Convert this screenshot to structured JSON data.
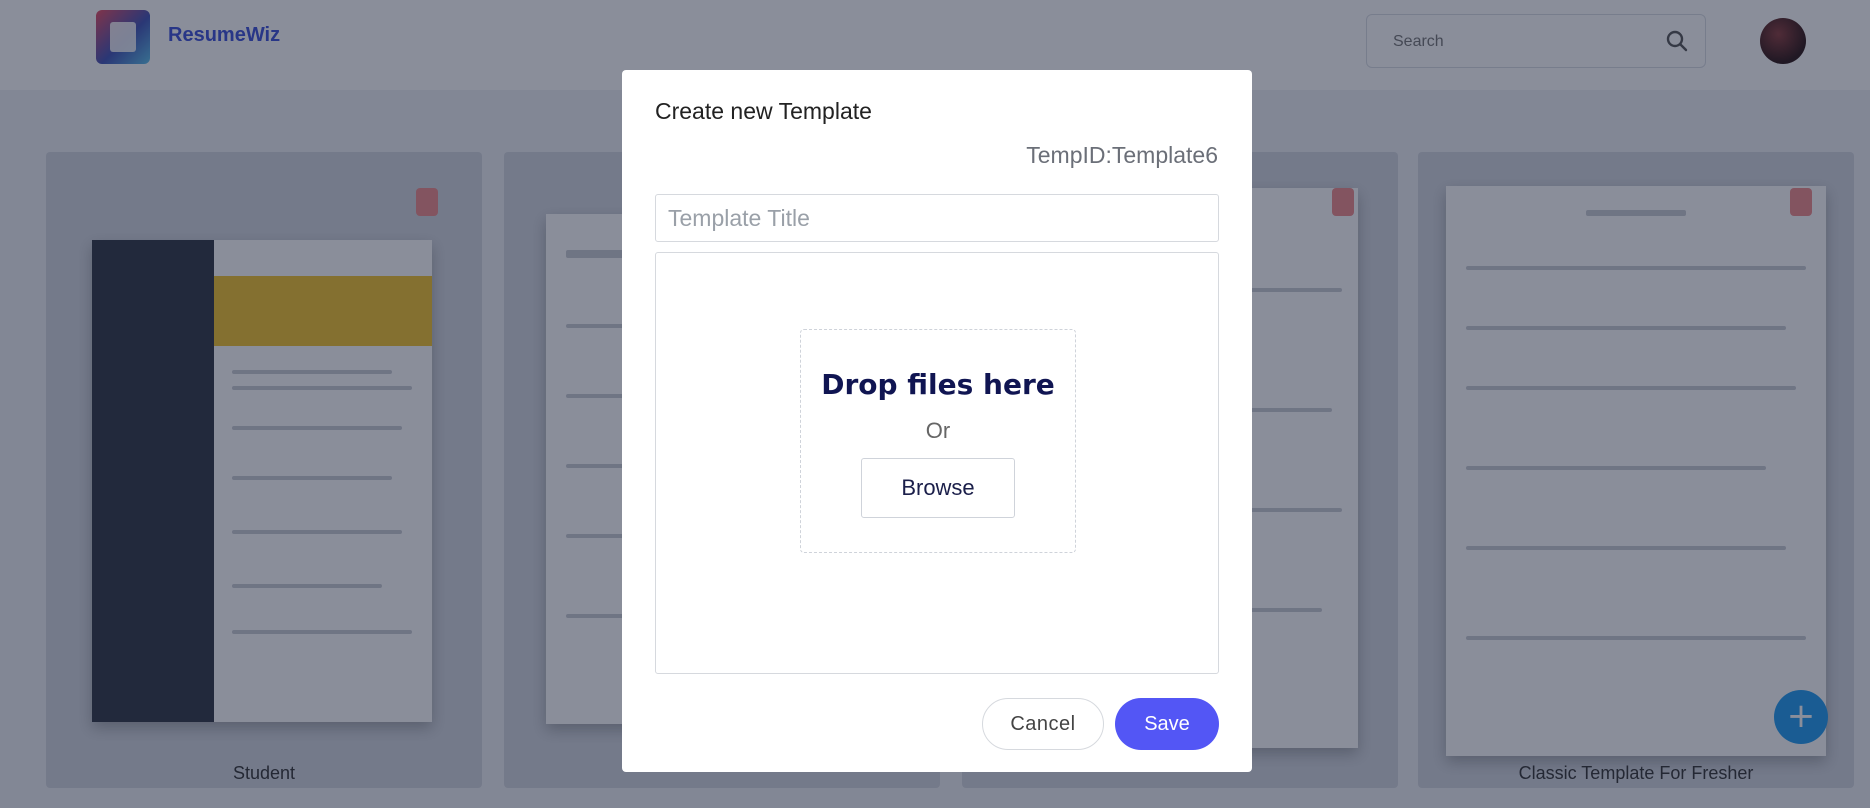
{
  "header": {
    "logo_text": "ResumeWiz",
    "search_placeholder": "Search"
  },
  "templates": [
    {
      "label": "Student"
    },
    {
      "label": ""
    },
    {
      "label": ""
    },
    {
      "label": "Classic Template For Fresher"
    }
  ],
  "modal": {
    "title": "Create new Template",
    "temp_id": "TempID:Template6",
    "title_placeholder": "Template Title",
    "drop_text": "Drop files here",
    "or_text": "Or",
    "browse_label": "Browse",
    "cancel_label": "Cancel",
    "save_label": "Save"
  },
  "colors": {
    "accent": "#5356f5",
    "drop_title": "#101552",
    "overlay": "rgba(22,30,54,0.5)"
  }
}
